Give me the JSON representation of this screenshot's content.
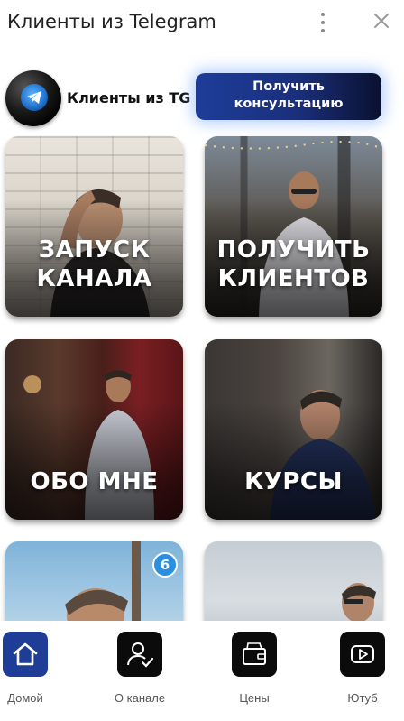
{
  "window": {
    "title": "Клиенты из Telegram",
    "menu_icon": "kebab-menu-icon",
    "close_icon": "close-icon"
  },
  "channel": {
    "name": "Клиенты из TG",
    "avatar_icon": "telegram-ball-icon",
    "cta_label_line1": "Получить",
    "cta_label_line2": "консультацию"
  },
  "tiles": [
    {
      "line1": "ЗАПУСК",
      "line2": "КАНАЛА"
    },
    {
      "line1": "ПОЛУЧИТЬ",
      "line2": "КЛИЕНТОВ"
    },
    {
      "line1": "ОБО МНЕ",
      "line2": ""
    },
    {
      "line1": "КУРСЫ",
      "line2": ""
    },
    {
      "line1": "",
      "line2": "",
      "badge": "6"
    },
    {
      "line1": "",
      "line2": ""
    }
  ],
  "nav": [
    {
      "label": "Домой",
      "icon": "home-icon",
      "active": true
    },
    {
      "label": "О канале",
      "icon": "user-check-icon",
      "active": false
    },
    {
      "label": "Цены",
      "icon": "wallet-icon",
      "active": false
    },
    {
      "label": "Ютуб",
      "icon": "youtube-play-icon",
      "active": false
    }
  ],
  "colors": {
    "accent": "#1f3d96",
    "badge": "#2a8fe0"
  }
}
